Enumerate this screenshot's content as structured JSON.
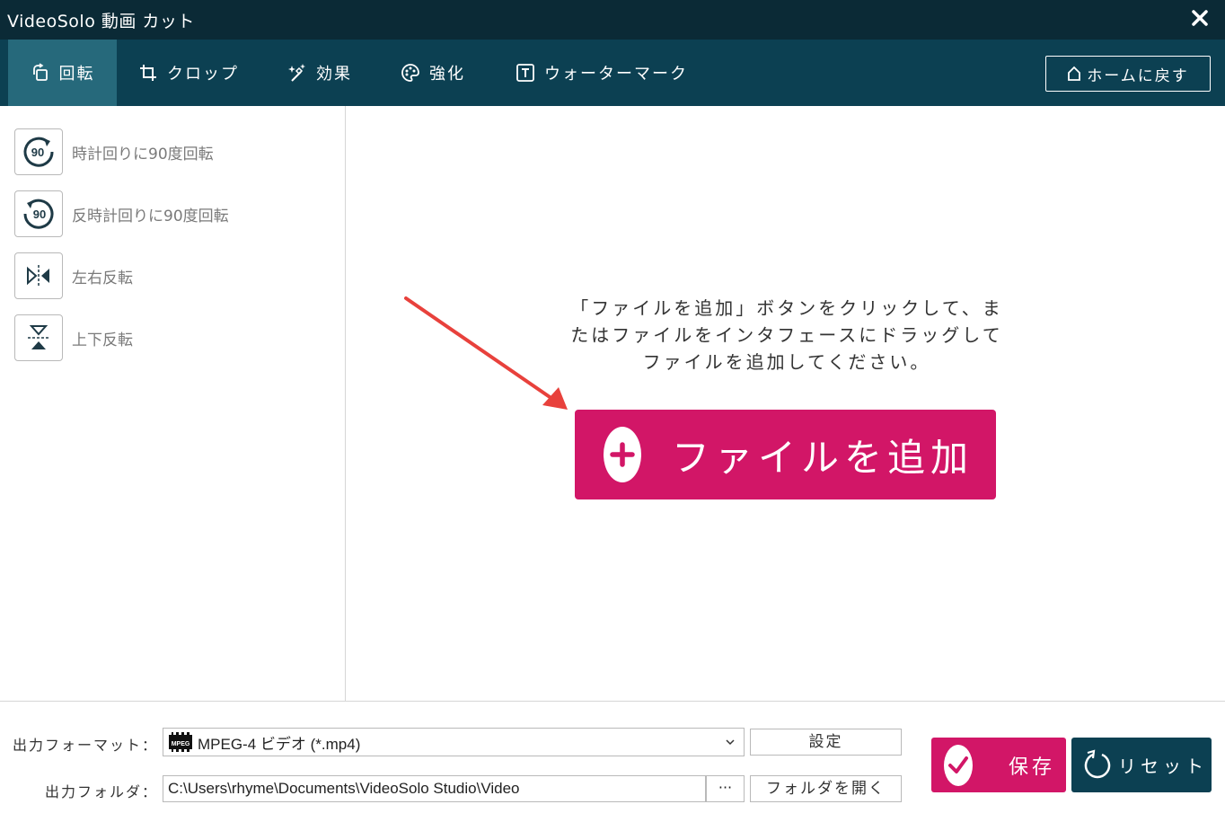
{
  "window": {
    "title": "VideoSolo 動画 カット"
  },
  "tabs": [
    {
      "label": "回転",
      "icon": "rotate-icon",
      "active": true
    },
    {
      "label": "クロップ",
      "icon": "crop-icon",
      "active": false
    },
    {
      "label": "効果",
      "icon": "effects-icon",
      "active": false
    },
    {
      "label": "強化",
      "icon": "enhance-palette-icon",
      "active": false
    },
    {
      "label": "ウォーターマーク",
      "icon": "watermark-text-icon",
      "active": false
    }
  ],
  "header": {
    "home_label": "ホームに戻す"
  },
  "sidebar": {
    "items": [
      {
        "label": "時計回りに90度回転",
        "icon": "rotate-clockwise-90-icon",
        "icon_text": "90"
      },
      {
        "label": "反時計回りに90度回転",
        "icon": "rotate-counterclockwise-90-icon",
        "icon_text": "90"
      },
      {
        "label": "左右反転",
        "icon": "flip-horizontal-icon"
      },
      {
        "label": "上下反転",
        "icon": "flip-vertical-icon"
      }
    ]
  },
  "main": {
    "hint_lines": [
      "「ファイルを追加」ボタンをクリックして、ま",
      "たはファイルをインタフェースにドラッグして",
      "ファイルを追加してください。"
    ],
    "add_button_label": "ファイルを追加"
  },
  "output": {
    "format_label": "出力フォーマット：",
    "format_value": "MPEG-4 ビデオ (*.mp4)",
    "format_icon_text": "MPEG",
    "settings_label": "設定",
    "folder_label": "出力フォルダ：",
    "folder_value": "C:\\Users\\rhyme\\Documents\\VideoSolo Studio\\Video",
    "browse_label": "···",
    "open_folder_label": "フォルダを開く",
    "save_label": "保存",
    "reset_label": "リセット"
  },
  "colors": {
    "titlebar": "#0b2a36",
    "tabbar": "#0c4052",
    "active_tab": "#26697b",
    "accent": "#d21667",
    "annotation_arrow": "#e8413c"
  }
}
